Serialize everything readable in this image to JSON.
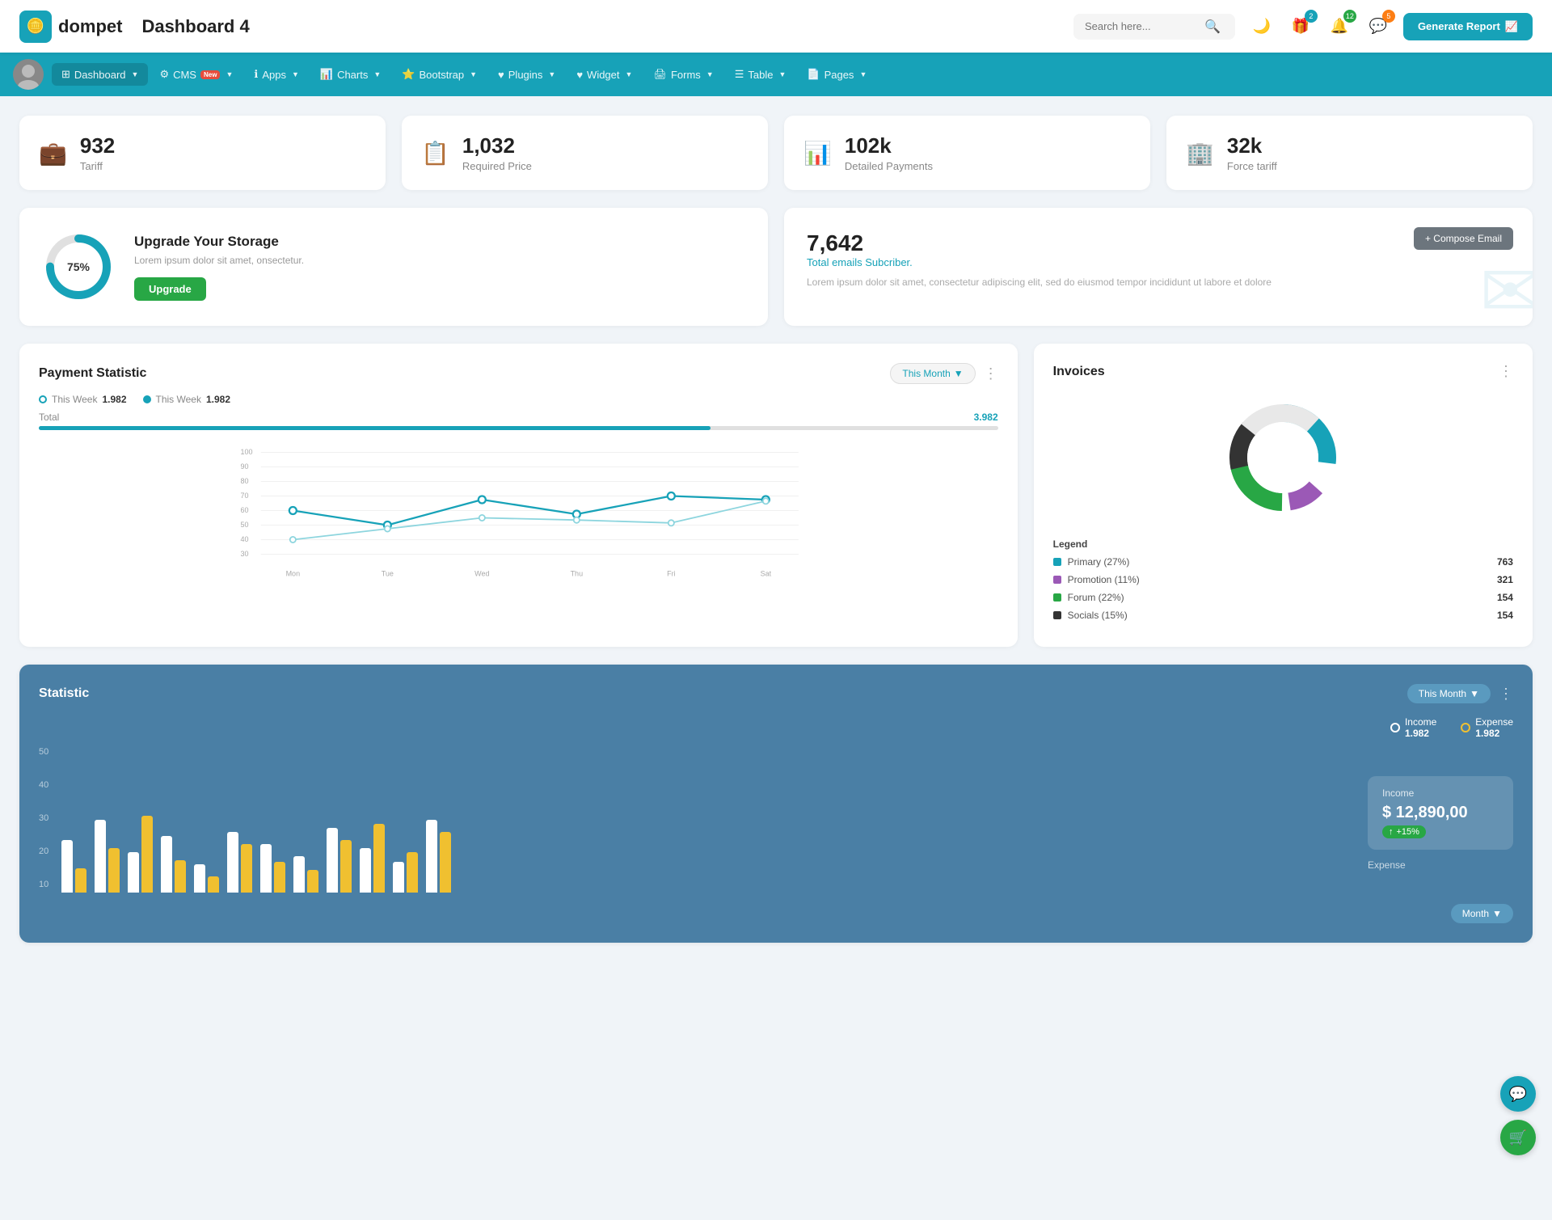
{
  "app": {
    "name": "dompet",
    "page_title": "Dashboard 4"
  },
  "header": {
    "search_placeholder": "Search here...",
    "generate_btn": "Generate Report",
    "badges": {
      "gift": "2",
      "bell": "12",
      "chat": "5"
    }
  },
  "nav": {
    "items": [
      {
        "id": "dashboard",
        "label": "Dashboard",
        "active": true,
        "icon": "⊞"
      },
      {
        "id": "cms",
        "label": "CMS",
        "active": false,
        "icon": "⚙",
        "badge_new": "New"
      },
      {
        "id": "apps",
        "label": "Apps",
        "active": false,
        "icon": "ℹ"
      },
      {
        "id": "charts",
        "label": "Charts",
        "active": false,
        "icon": "📊"
      },
      {
        "id": "bootstrap",
        "label": "Bootstrap",
        "active": false,
        "icon": "⭐"
      },
      {
        "id": "plugins",
        "label": "Plugins",
        "active": false,
        "icon": "♥"
      },
      {
        "id": "widget",
        "label": "Widget",
        "active": false,
        "icon": "♥"
      },
      {
        "id": "forms",
        "label": "Forms",
        "active": false,
        "icon": "🖨"
      },
      {
        "id": "table",
        "label": "Table",
        "active": false,
        "icon": "☰"
      },
      {
        "id": "pages",
        "label": "Pages",
        "active": false,
        "icon": "📄"
      }
    ]
  },
  "stats": [
    {
      "id": "tariff",
      "value": "932",
      "label": "Tariff",
      "icon": "💼",
      "color": "#17a2b8"
    },
    {
      "id": "required-price",
      "value": "1,032",
      "label": "Required Price",
      "icon": "📋",
      "color": "#e74c3c"
    },
    {
      "id": "detailed-payments",
      "value": "102k",
      "label": "Detailed Payments",
      "icon": "📊",
      "color": "#9b59b6"
    },
    {
      "id": "force-tariff",
      "value": "32k",
      "label": "Force tariff",
      "icon": "🏢",
      "color": "#e91e9a"
    }
  ],
  "storage": {
    "title": "Upgrade Your Storage",
    "description": "Lorem ipsum dolor sit amet, onsectetur.",
    "percent": 75,
    "percent_label": "75%",
    "upgrade_btn": "Upgrade"
  },
  "email": {
    "count": "7,642",
    "label": "Total emails Subcriber.",
    "description": "Lorem ipsum dolor sit amet, consectetur adipiscing elit, sed do eiusmod tempor incididunt ut labore et dolore",
    "compose_btn": "+ Compose Email"
  },
  "payment": {
    "title": "Payment Statistic",
    "filter_btn": "This Month",
    "legend1_label": "This Week",
    "legend1_value": "1.982",
    "legend2_label": "This Week",
    "legend2_value": "1.982",
    "total_label": "Total",
    "total_value": "3.982",
    "x_labels": [
      "Mon",
      "Tue",
      "Wed",
      "Thu",
      "Fri",
      "Sat"
    ],
    "y_labels": [
      "100",
      "90",
      "80",
      "70",
      "60",
      "50",
      "40",
      "30"
    ],
    "line1_points": "40,145 170,110 300,95 430,85 560,100 690,75",
    "line2_points": "40,130 170,120 300,110 430,108 560,112 690,80 760,85"
  },
  "invoices": {
    "title": "Invoices",
    "legend": [
      {
        "label": "Primary (27%)",
        "color": "#17a2b8",
        "value": "763"
      },
      {
        "label": "Promotion (11%)",
        "color": "#9b59b6",
        "value": "321"
      },
      {
        "label": "Forum (22%)",
        "color": "#28a745",
        "value": "154"
      },
      {
        "label": "Socials (15%)",
        "color": "#333",
        "value": "154"
      }
    ]
  },
  "statistic": {
    "title": "Statistic",
    "filter_btn": "This Month",
    "income_label": "Income",
    "income_value": "1.982",
    "expense_label": "Expense",
    "expense_value": "1.982",
    "income_box_title": "Income",
    "income_box_value": "$ 12,890,00",
    "income_badge": "+15%",
    "y_labels": [
      "50",
      "40",
      "30",
      "20",
      "10"
    ],
    "bars": [
      {
        "white": 60,
        "yellow": 30
      },
      {
        "white": 80,
        "yellow": 50
      },
      {
        "white": 45,
        "yellow": 90
      },
      {
        "white": 65,
        "yellow": 40
      },
      {
        "white": 30,
        "yellow": 20
      },
      {
        "white": 70,
        "yellow": 55
      },
      {
        "white": 55,
        "yellow": 35
      },
      {
        "white": 40,
        "yellow": 25
      },
      {
        "white": 75,
        "yellow": 60
      },
      {
        "white": 50,
        "yellow": 80
      },
      {
        "white": 35,
        "yellow": 45
      },
      {
        "white": 85,
        "yellow": 70
      }
    ]
  },
  "month_dropdown": "Month"
}
